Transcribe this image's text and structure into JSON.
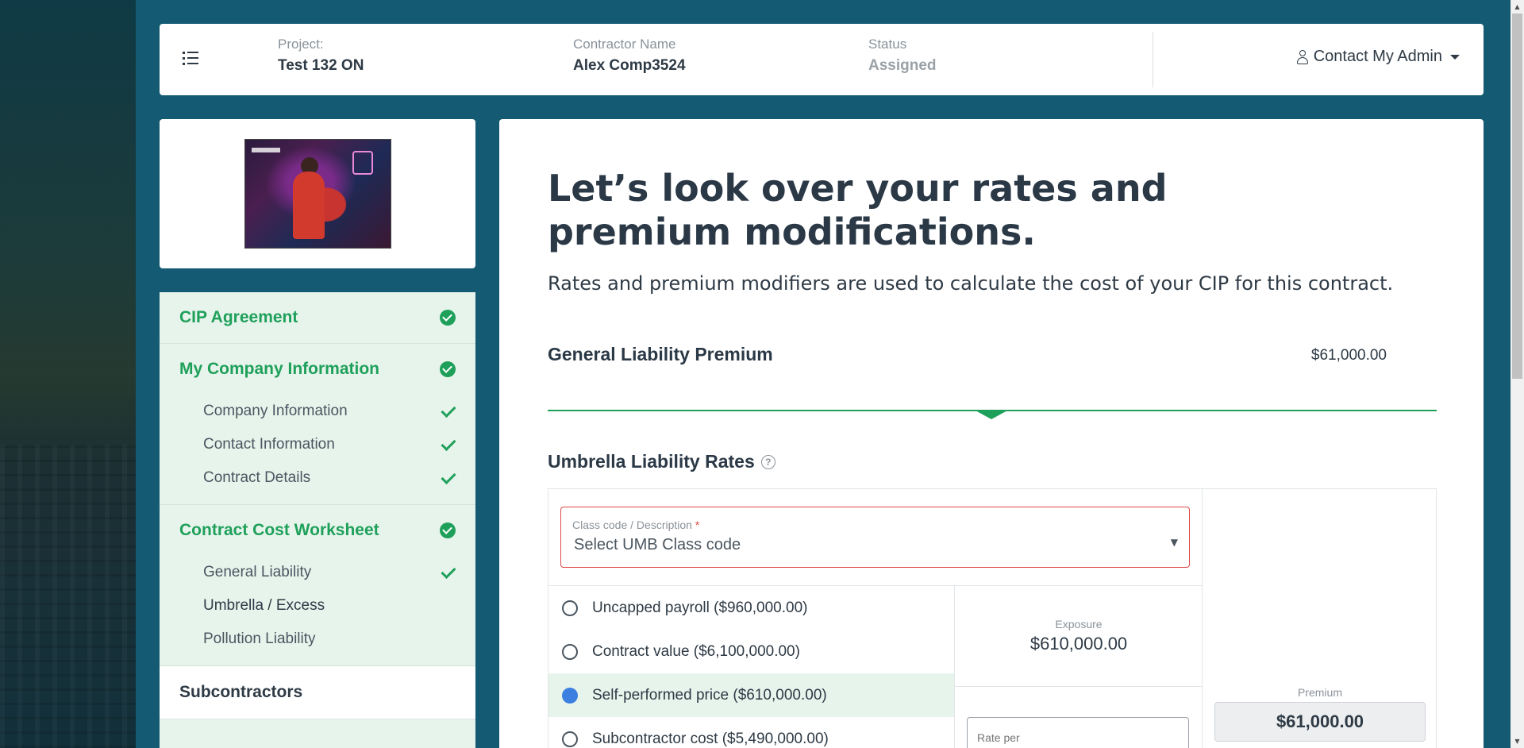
{
  "header": {
    "project_label": "Project:",
    "project_value": "Test 132 ON",
    "contractor_label": "Contractor Name",
    "contractor_value": "Alex Comp3524",
    "status_label": "Status",
    "status_value": "Assigned",
    "contact_admin": "Contact My Admin"
  },
  "sidebar": {
    "sections": [
      {
        "label": "CIP Agreement",
        "complete": true,
        "items": []
      },
      {
        "label": "My Company Information",
        "complete": true,
        "items": [
          {
            "label": "Company Information",
            "complete": true
          },
          {
            "label": "Contact Information",
            "complete": true
          },
          {
            "label": "Contract Details",
            "complete": true
          }
        ]
      },
      {
        "label": "Contract Cost Worksheet",
        "complete": true,
        "items": [
          {
            "label": "General Liability",
            "complete": true
          },
          {
            "label": "Umbrella / Excess",
            "complete": false,
            "active": true
          },
          {
            "label": "Pollution Liability",
            "complete": false
          }
        ]
      }
    ],
    "subcontractors": "Subcontractors"
  },
  "main": {
    "title": "Let’s look over your rates and premium modifications.",
    "subtitle": "Rates and premium modifiers are used to calculate the cost of your CIP for this contract.",
    "gl_title": "General Liability Premium",
    "gl_amount": "$61,000.00",
    "umb_title": "Umbrella Liability Rates",
    "class_code": {
      "label": "Class code / Description",
      "required_mark": "*",
      "value": "Select UMB Class code"
    },
    "options": [
      {
        "label": "Uncapped payroll ($960,000.00)",
        "selected": false
      },
      {
        "label": "Contract value ($6,100,000.00)",
        "selected": false
      },
      {
        "label": "Self-performed price ($610,000.00)",
        "selected": true
      },
      {
        "label": "Subcontractor cost ($5,490,000.00)",
        "selected": false
      }
    ],
    "exposure_label": "Exposure",
    "exposure_value": "$610,000.00",
    "rate_placeholder": "Rate per",
    "premium_label": "Premium",
    "premium_value": "$61,000.00"
  },
  "colors": {
    "accent_green": "#1fa05a",
    "background_teal": "#145a73",
    "radio_blue": "#3b7fe0",
    "error_red": "#e04848"
  }
}
